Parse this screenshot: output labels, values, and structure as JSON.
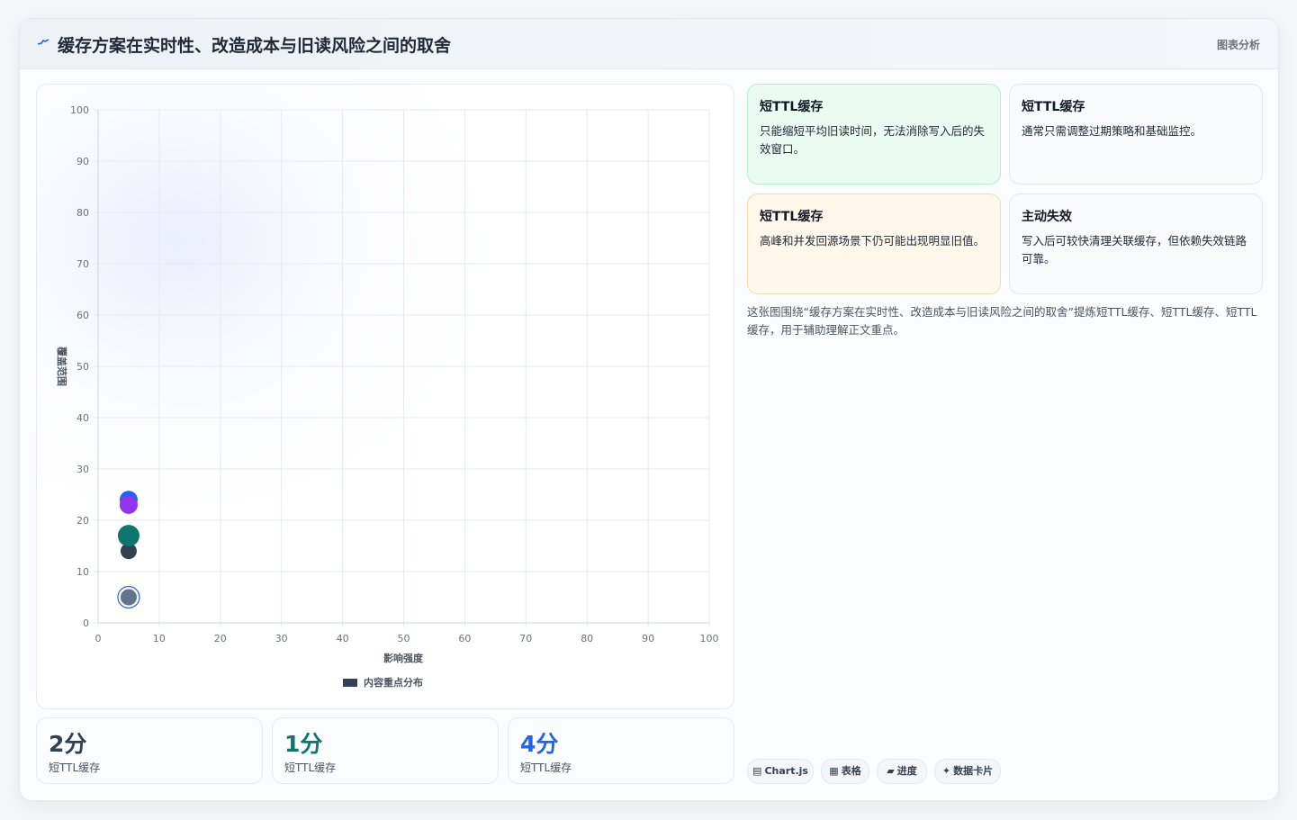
{
  "header": {
    "title": "缓存方案在实时性、改造成本与旧读风险之间的取舍",
    "tag": "图表分析"
  },
  "chart_data": {
    "type": "scatter",
    "xlabel": "影响强度",
    "ylabel": "覆盖范围",
    "xlim": [
      0,
      100
    ],
    "ylim": [
      0,
      100
    ],
    "x_ticks": [
      "0",
      "10",
      "20",
      "30",
      "40",
      "50",
      "60",
      "70",
      "80",
      "90",
      "100"
    ],
    "y_ticks": [
      "0",
      "10",
      "20",
      "30",
      "40",
      "50",
      "60",
      "70",
      "80",
      "90",
      "100"
    ],
    "grid": true,
    "legend": {
      "label": "内容重点分布",
      "position": "bottom"
    },
    "points": [
      {
        "x": 5,
        "y": 24,
        "color": "#2563eb"
      },
      {
        "x": 5,
        "y": 23,
        "color": "#9333ea"
      },
      {
        "x": 5,
        "y": 14,
        "color": "#334155"
      },
      {
        "x": 5,
        "y": 17,
        "color": "#0f766e"
      },
      {
        "x": 5,
        "y": 5,
        "color": "#64748b"
      }
    ]
  },
  "stats": [
    {
      "value": "2分",
      "label": "短TTL缓存",
      "color": "#334155"
    },
    {
      "value": "1分",
      "label": "短TTL缓存",
      "color": "#0f766e"
    },
    {
      "value": "4分",
      "label": "短TTL缓存",
      "color": "#2563eb"
    }
  ],
  "cards": [
    {
      "title": "短TTL缓存",
      "text": "只能缩短平均旧读时间，无法消除写入后的失效窗口。"
    },
    {
      "title": "短TTL缓存",
      "text": "通常只需调整过期策略和基础监控。"
    },
    {
      "title": "短TTL缓存",
      "text": "高峰和并发回源场景下仍可能出现明显旧值。"
    },
    {
      "title": "主动失效",
      "text": "写入后可较快清理关联缓存，但依赖失效链路可靠。"
    }
  ],
  "summary": "这张图围绕“缓存方案在实时性、改造成本与旧读风险之间的取舍”提炼短TTL缓存、短TTL缓存、短TTL缓存，用于辅助理解正文重点。",
  "chips": [
    {
      "icon": "▤",
      "label": "Chart.js"
    },
    {
      "icon": "▦",
      "label": "表格"
    },
    {
      "icon": "▰",
      "label": "进度"
    },
    {
      "icon": "✦",
      "label": "数据卡片"
    }
  ]
}
